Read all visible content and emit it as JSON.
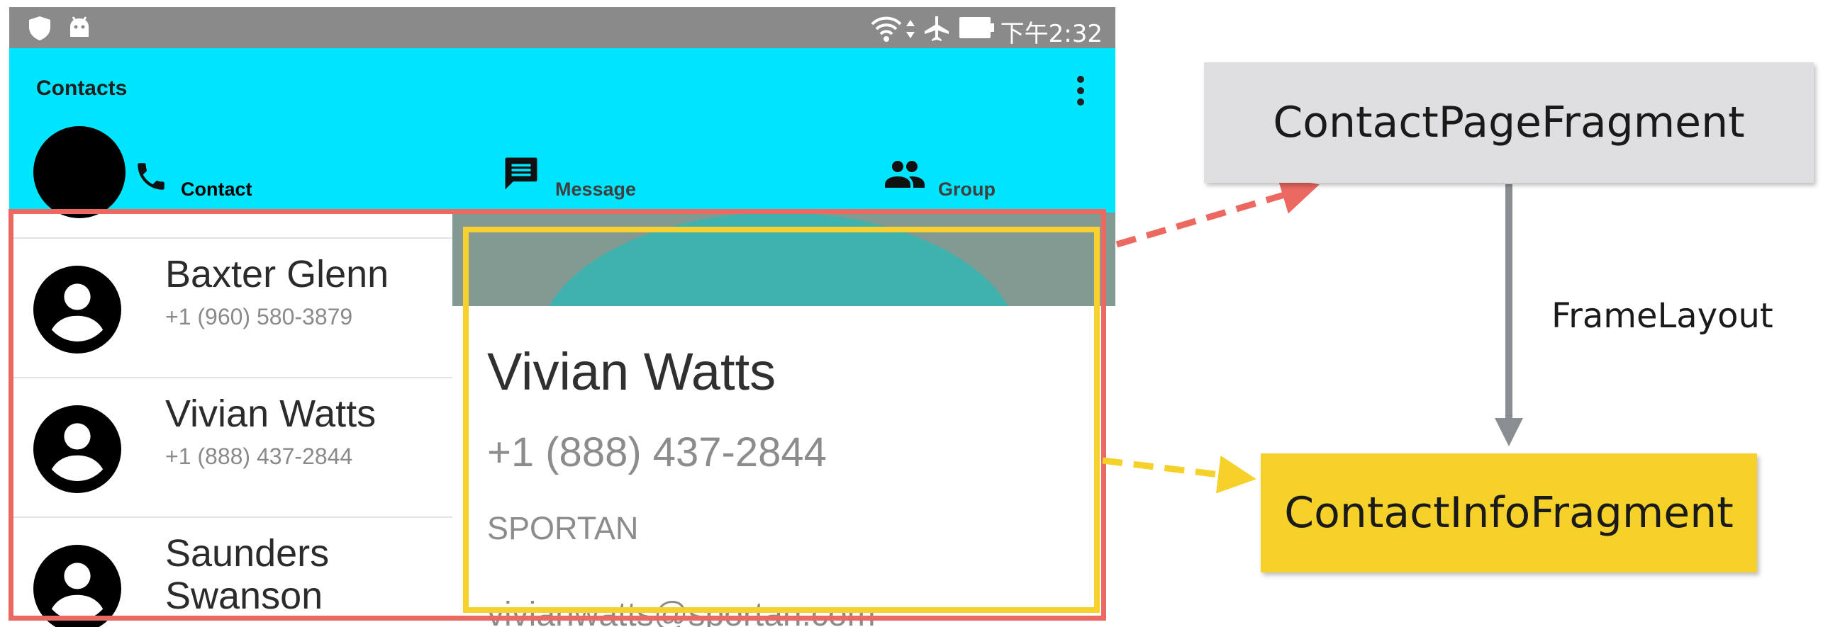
{
  "status_bar": {
    "time": "下午2:32",
    "icons": [
      "shield-icon",
      "android-icon",
      "wifi-icon",
      "data-arrows-icon",
      "airplane-icon",
      "battery-icon"
    ]
  },
  "app_bar": {
    "title": "Contacts",
    "menu_icon": "more-vert-icon"
  },
  "tabs": [
    {
      "label": "Contact",
      "icon": "phone-icon"
    },
    {
      "label": "Message",
      "icon": "message-icon"
    },
    {
      "label": "Group",
      "icon": "group-icon"
    }
  ],
  "contacts": [
    {
      "name": "Baxter Glenn",
      "phone": "+1 (960) 580-3879"
    },
    {
      "name": "Vivian Watts",
      "phone": "+1 (888) 437-2844"
    },
    {
      "name": "Saunders Swanson",
      "phone": ""
    }
  ],
  "contact_info": {
    "name": "Vivian Watts",
    "phone": "+1 (888) 437-2844",
    "company": "SPORTAN",
    "email": "vivianwatts@sportan.com"
  },
  "diagram": {
    "nodes": [
      {
        "id": "page",
        "label": "ContactPageFragment",
        "color": "#dfdfe1"
      },
      {
        "id": "info",
        "label": "ContactInfoFragment",
        "color": "#f5d12a"
      }
    ],
    "edge_label": "FrameLayout",
    "colors": {
      "red_frame": "#ec6961",
      "yellow_frame": "#f7d12e",
      "connector": "#8a8d91"
    }
  }
}
